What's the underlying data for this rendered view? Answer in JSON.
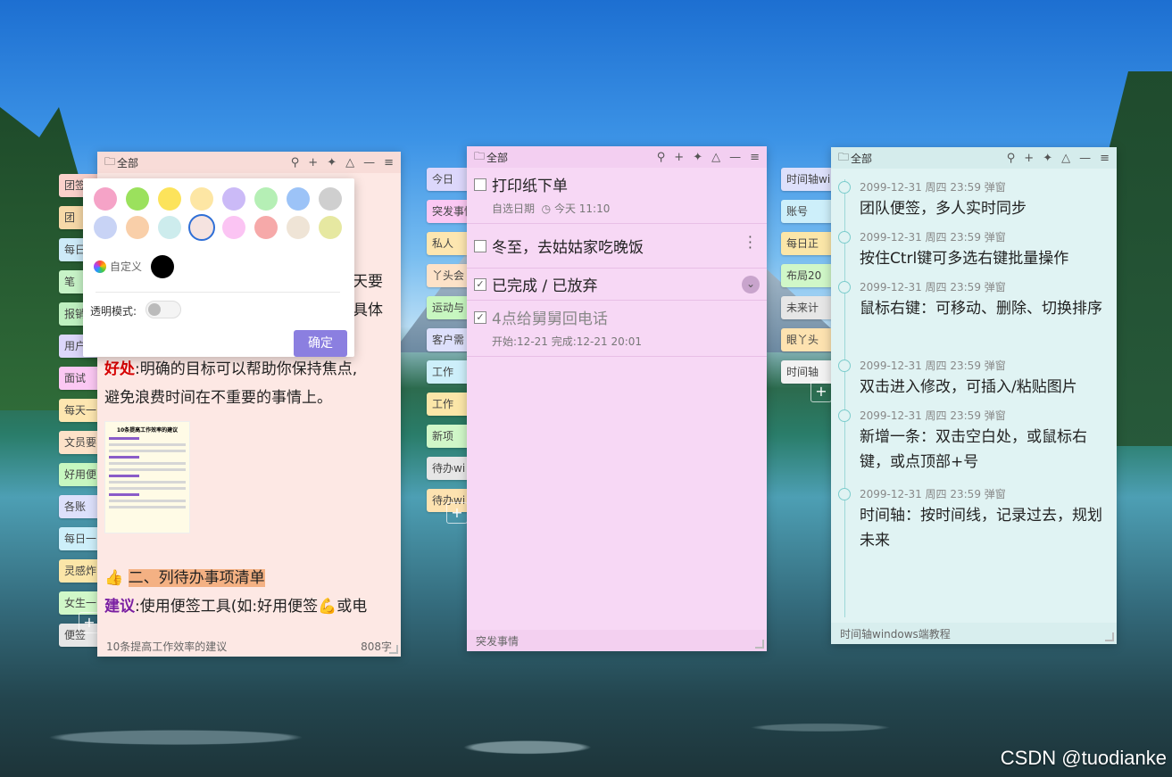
{
  "desktop": {
    "watermark": "CSDN @tuodianke"
  },
  "left_tabs": [
    "团签",
    "团",
    "每日",
    "笔",
    "报销",
    "用户",
    "面试",
    "每天一",
    "文员要",
    "好用便",
    "各账",
    "每日一",
    "灵感炸",
    "女生一",
    "便签"
  ],
  "mid_tabs": [
    "今日",
    "突发事情",
    "私人",
    "丫头会",
    "运动与",
    "客户需",
    "工作",
    "工作",
    "新项",
    "待办wi",
    "待办wi"
  ],
  "right_tabs": [
    "时间轴wi",
    "账号",
    "每日正",
    "布局20",
    "未来计",
    "眼丫头",
    "时间轴"
  ],
  "win_left": {
    "title": "全部",
    "text_line1_tail": "天要",
    "text_line2_tail": "具体",
    "text_line3_label": "好处",
    "text_line3_rest": ":明确的目标可以帮助你保持焦点,",
    "text_line4": "避免浪费时间在不重要的事情上。",
    "thumb_title": "10条提高工作效率的建议",
    "heading_emoji": "👍",
    "heading": "二、列待办事项清单",
    "suggest_label": "建议",
    "suggest_rest": ":使用便签工具(如:好用便签💪或电",
    "footer_left": "10条提高工作效率的建议",
    "footer_right": "808字"
  },
  "color_popup": {
    "swatches": [
      "#f5a3c7",
      "#9be15d",
      "#fce35b",
      "#fde6a4",
      "#cbbaf7",
      "#b5efb5",
      "#9cc3f7",
      "#cfcfcf",
      "#c8d3f5",
      "#f9cfa9",
      "#cdeced",
      "#f5e3e0",
      "#fbc4f3",
      "#f6a9a9",
      "#efe4d6",
      "#e6e8a1"
    ],
    "custom_label": "自定义",
    "transparent_label": "透明模式:",
    "ok_label": "确定"
  },
  "win_mid": {
    "title": "全部",
    "todos": [
      {
        "title": "打印纸下单",
        "sub1": "自选日期",
        "sub2": "今天 11:10"
      },
      {
        "title": "冬至，去姑姑家吃晚饭"
      }
    ],
    "done_section": "已完成 / 已放弃",
    "done_item": {
      "title": "4点给舅舅回电话",
      "sub": "开始:12-21  完成:12-21 20:01"
    },
    "footer": "突发事情"
  },
  "win_right": {
    "title": "全部",
    "items": [
      {
        "meta": "2099-12-31 周四 23:59  弹窗",
        "text": "团队便签，多人实时同步"
      },
      {
        "meta": "2099-12-31 周四 23:59  弹窗",
        "text": "按住Ctrl键可多选右键批量操作"
      },
      {
        "meta": "2099-12-31 周四 23:59  弹窗",
        "text": "鼠标右键：可移动、删除、切换排序"
      },
      {
        "meta": "2099-12-31 周四 23:59  弹窗",
        "text": "双击进入修改，可插入/粘贴图片"
      },
      {
        "meta": "2099-12-31 周四 23:59  弹窗",
        "text": "新增一条：双击空白处，或鼠标右键，或点顶部+号"
      },
      {
        "meta": "2099-12-31 周四 23:59  弹窗",
        "text": "时间轴：按时间线，记录过去，规划未来"
      }
    ],
    "footer": "时间轴windows端教程"
  },
  "icons": [
    "folder-icon",
    "search-icon",
    "plus-icon",
    "pin-icon",
    "skin-icon",
    "minimize-icon",
    "menu-icon"
  ]
}
